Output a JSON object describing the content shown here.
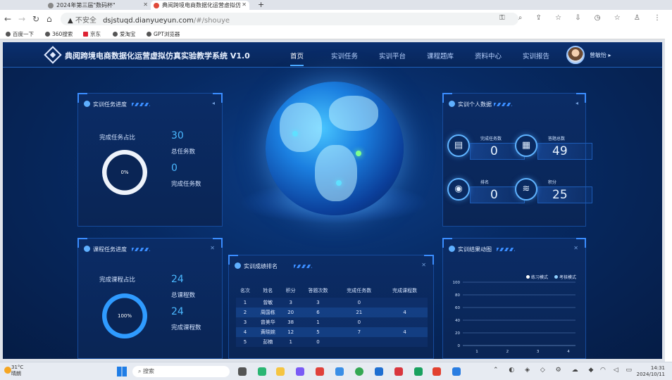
{
  "browser": {
    "tabs": [
      {
        "title": "2024年第三届\"数码杯\""
      },
      {
        "title": "典阅跨境电商数据化运营虚拟仿"
      }
    ],
    "url_insecure": "不安全",
    "url_host": "dsjstuqd.dianyueyun.com",
    "url_path": "/#/shouye",
    "bookmarks": [
      "百度一下",
      "360搜索",
      "京东",
      "爱淘宝",
      "GPT浏览器"
    ]
  },
  "app": {
    "title": "典阅跨境电商数据化运营虚拟仿真实验教学系统 V1.0",
    "nav": [
      "首页",
      "实训任务",
      "实训平台",
      "课程题库",
      "资料中心",
      "实训报告"
    ],
    "user_name": "曾敏怡"
  },
  "task_progress": {
    "title": "实训任务进度",
    "ratio_label": "完成任务占比",
    "percent_text": "0%",
    "percent": 0,
    "total_value": "30",
    "total_label": "总任务数",
    "done_value": "0",
    "done_label": "完成任务数"
  },
  "course_progress": {
    "title": "课程任务进度",
    "ratio_label": "完成课程占比",
    "percent_text": "100%",
    "percent": 100,
    "total_value": "24",
    "total_label": "总课程数",
    "done_value": "24",
    "done_label": "完成课程数"
  },
  "personal": {
    "title": "实训个人数据",
    "stats": [
      {
        "label": "完成任务数",
        "value": "0",
        "icon": "clipboard-icon"
      },
      {
        "label": "答题总数",
        "value": "49",
        "icon": "document-icon"
      },
      {
        "label": "排名",
        "value": "0",
        "icon": "medal-icon"
      },
      {
        "label": "积分",
        "value": "25",
        "icon": "coins-icon"
      }
    ]
  },
  "ranking": {
    "title": "实训成绩排名",
    "headers": [
      "名次",
      "姓名",
      "积分",
      "答题次数",
      "完成任务数",
      "完成课程数"
    ],
    "rows": [
      [
        "1",
        "曾敏",
        "3",
        "3",
        "0",
        ""
      ],
      [
        "2",
        "周国栋",
        "20",
        "6",
        "21",
        "4"
      ],
      [
        "3",
        "曾美华",
        "38",
        "1",
        "0",
        ""
      ],
      [
        "4",
        "黄晓婉",
        "12",
        "5",
        "7",
        "4"
      ],
      [
        "5",
        "彭楠",
        "1",
        "0",
        "",
        ""
      ]
    ]
  },
  "trend": {
    "title": "实训结果动图",
    "legend": [
      "练习模式",
      "考核模式"
    ],
    "y_ticks": [
      "100",
      "80",
      "60",
      "40",
      "20",
      "0"
    ],
    "x_ticks": [
      "1",
      "2",
      "3",
      "4"
    ]
  },
  "taskbar": {
    "temperature": "31°C",
    "weather": "晴朗",
    "search_placeholder": "搜索",
    "time": "14:31",
    "date": "2024/10/11"
  }
}
